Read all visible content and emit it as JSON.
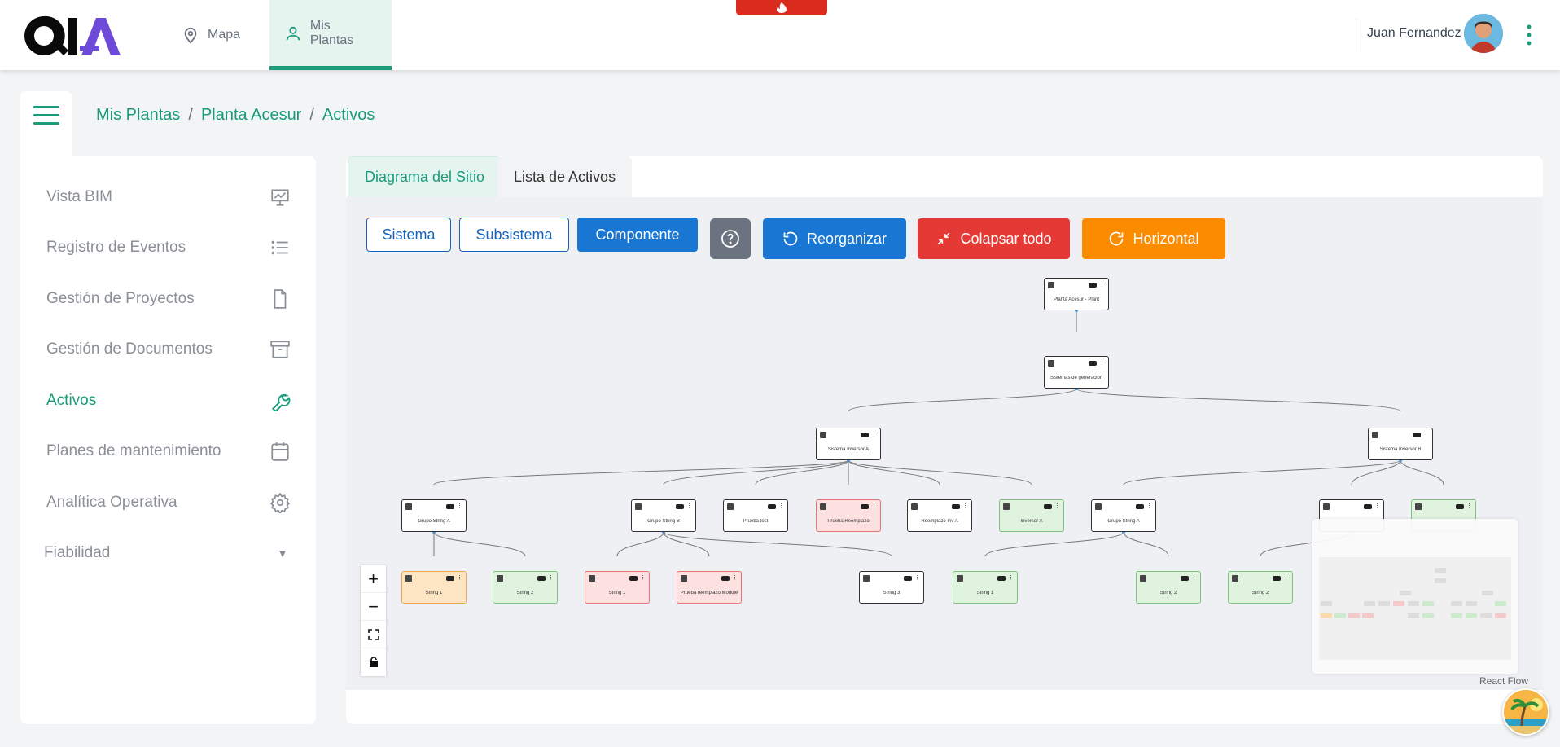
{
  "topbar": {
    "nav": [
      {
        "label": "Mapa",
        "icon": "map-pin-icon"
      },
      {
        "label": "Mis Plantas",
        "icon": "user-icon"
      }
    ],
    "user_name": "Juan Fernandez"
  },
  "breadcrumb": [
    "Mis Plantas",
    "Planta Acesur",
    "Activos"
  ],
  "sidebar": {
    "items": [
      {
        "label": "Vista BIM",
        "icon": "presentation-icon"
      },
      {
        "label": "Registro de Eventos",
        "icon": "list-icon"
      },
      {
        "label": "Gestión de Proyectos",
        "icon": "file-icon"
      },
      {
        "label": "Gestión de Documentos",
        "icon": "archive-icon"
      },
      {
        "label": "Activos",
        "icon": "wrench-icon",
        "active": true
      },
      {
        "label": "Planes de mantenimiento",
        "icon": "calendar-icon"
      },
      {
        "label": "Analítica Operativa",
        "icon": "gear-icon"
      }
    ],
    "fiabilidad": "Fiabilidad"
  },
  "tabs": [
    "Diagrama del Sitio",
    "Lista de Activos"
  ],
  "toolbar": {
    "sistema": "Sistema",
    "subsistema": "Subsistema",
    "componente": "Componente",
    "reorganizar": "Reorganizar",
    "colapsar": "Colapsar todo",
    "horizontal": "Horizontal"
  },
  "diagram": {
    "nodes": [
      {
        "id": "root",
        "title": "Planta Acesur - Plant",
        "status": "default"
      },
      {
        "id": "gen",
        "title": "Sistemas de generación",
        "status": "default"
      },
      {
        "id": "invA",
        "title": "Sistema Inversor A",
        "status": "default"
      },
      {
        "id": "invB",
        "title": "Sistema Inversor B",
        "status": "default"
      },
      {
        "id": "gsa",
        "title": "Grupo String A",
        "status": "default"
      },
      {
        "id": "gsb",
        "title": "Grupo String B",
        "status": "default"
      },
      {
        "id": "ptest",
        "title": "Prueba test",
        "status": "default"
      },
      {
        "id": "preem",
        "title": "Prueba Reemplazo",
        "status": "red"
      },
      {
        "id": "reem",
        "title": "Reemplazo Inv A",
        "status": "default"
      },
      {
        "id": "inva",
        "title": "Inversor A",
        "status": "green"
      },
      {
        "id": "gsa2",
        "title": "Grupo String A",
        "status": "default"
      },
      {
        "id": "s1a",
        "title": "String 1",
        "status": "orange"
      },
      {
        "id": "s2a",
        "title": "String 2",
        "status": "green"
      },
      {
        "id": "s1b",
        "title": "String 1",
        "status": "red"
      },
      {
        "id": "prm",
        "title": "Prueba reemplazo Module",
        "status": "red"
      },
      {
        "id": "s3b",
        "title": "String 3",
        "status": "default"
      },
      {
        "id": "s1c",
        "title": "String 1",
        "status": "green"
      },
      {
        "id": "s2c",
        "title": "String 2",
        "status": "green"
      },
      {
        "id": "s2d",
        "title": "String 2",
        "status": "green"
      }
    ]
  },
  "react_flow_label": "React Flow",
  "colors": {
    "accent": "#1a9b7a",
    "primary": "#1976d2",
    "danger": "#e53935",
    "warning": "#fb8c00"
  }
}
